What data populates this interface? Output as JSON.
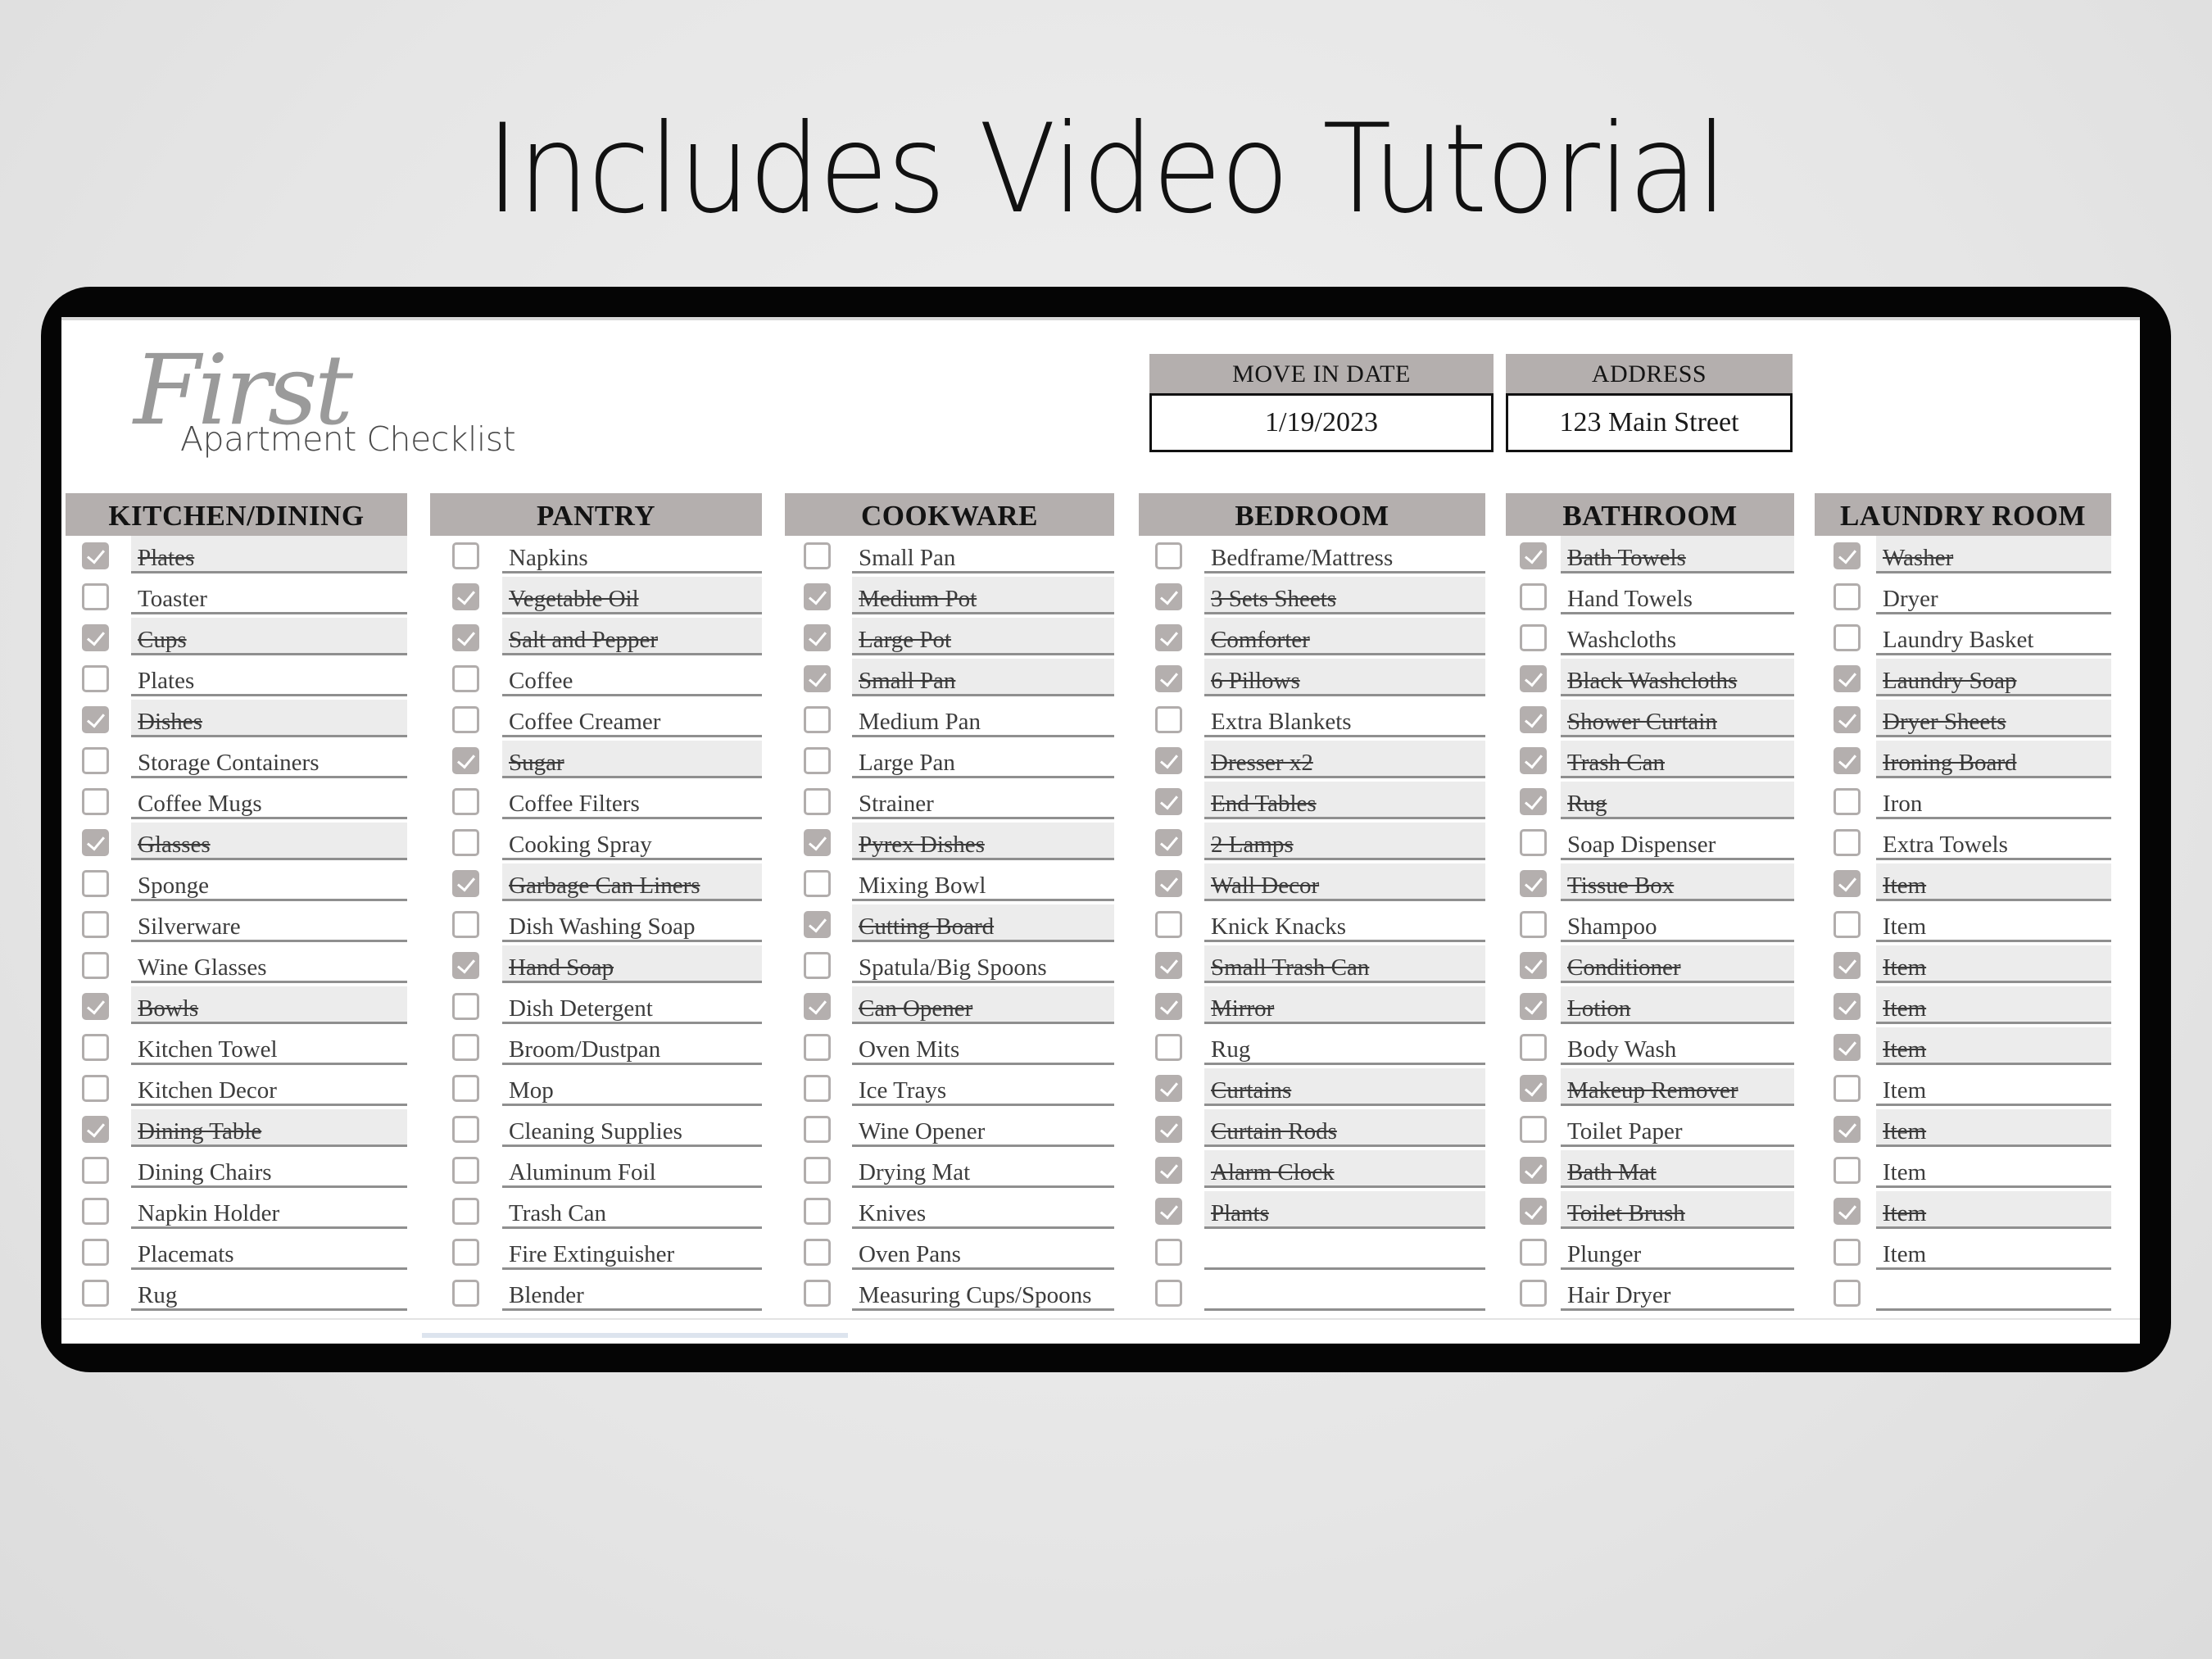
{
  "headline": "Includes Video Tutorial",
  "logo": {
    "script": "First",
    "subtitle": "Apartment Checklist"
  },
  "move_in": {
    "label": "MOVE IN DATE",
    "value": "1/19/2023"
  },
  "address": {
    "label": "ADDRESS",
    "value": "123 Main Street"
  },
  "colors": {
    "header_bg": "#b4afae",
    "checked_row_bg": "#ececec",
    "frame": "#050505"
  },
  "sections": [
    {
      "title": "KITCHEN/DINING",
      "items": [
        {
          "label": "Plates",
          "checked": true
        },
        {
          "label": "Toaster",
          "checked": false
        },
        {
          "label": "Cups",
          "checked": true
        },
        {
          "label": "Plates",
          "checked": false
        },
        {
          "label": "Dishes",
          "checked": true
        },
        {
          "label": "Storage Containers",
          "checked": false
        },
        {
          "label": "Coffee Mugs",
          "checked": false
        },
        {
          "label": "Glasses",
          "checked": true
        },
        {
          "label": "Sponge",
          "checked": false
        },
        {
          "label": "Silverware",
          "checked": false
        },
        {
          "label": "Wine Glasses",
          "checked": false
        },
        {
          "label": "Bowls",
          "checked": true
        },
        {
          "label": "Kitchen Towel",
          "checked": false
        },
        {
          "label": "Kitchen Decor",
          "checked": false
        },
        {
          "label": "Dining Table",
          "checked": true
        },
        {
          "label": "Dining Chairs",
          "checked": false
        },
        {
          "label": "Napkin Holder",
          "checked": false
        },
        {
          "label": "Placemats",
          "checked": false
        },
        {
          "label": "Rug",
          "checked": false
        }
      ]
    },
    {
      "title": "PANTRY",
      "items": [
        {
          "label": "Napkins",
          "checked": false
        },
        {
          "label": "Vegetable Oil",
          "checked": true
        },
        {
          "label": "Salt and Pepper",
          "checked": true
        },
        {
          "label": "Coffee",
          "checked": false
        },
        {
          "label": "Coffee Creamer",
          "checked": false
        },
        {
          "label": "Sugar",
          "checked": true
        },
        {
          "label": "Coffee Filters",
          "checked": false
        },
        {
          "label": "Cooking Spray",
          "checked": false
        },
        {
          "label": "Garbage Can Liners",
          "checked": true
        },
        {
          "label": "Dish Washing Soap",
          "checked": false
        },
        {
          "label": "Hand Soap",
          "checked": true
        },
        {
          "label": "Dish Detergent",
          "checked": false
        },
        {
          "label": "Broom/Dustpan",
          "checked": false
        },
        {
          "label": "Mop",
          "checked": false
        },
        {
          "label": "Cleaning Supplies",
          "checked": false
        },
        {
          "label": "Aluminum Foil",
          "checked": false
        },
        {
          "label": "Trash Can",
          "checked": false
        },
        {
          "label": "Fire Extinguisher",
          "checked": false
        },
        {
          "label": "Blender",
          "checked": false
        }
      ]
    },
    {
      "title": "COOKWARE",
      "items": [
        {
          "label": "Small Pan",
          "checked": false
        },
        {
          "label": "Medium Pot",
          "checked": true
        },
        {
          "label": "Large Pot",
          "checked": true
        },
        {
          "label": "Small Pan",
          "checked": true
        },
        {
          "label": "Medium Pan",
          "checked": false
        },
        {
          "label": "Large Pan",
          "checked": false
        },
        {
          "label": "Strainer",
          "checked": false
        },
        {
          "label": "Pyrex Dishes",
          "checked": true
        },
        {
          "label": "Mixing Bowl",
          "checked": false
        },
        {
          "label": "Cutting Board",
          "checked": true
        },
        {
          "label": "Spatula/Big Spoons",
          "checked": false
        },
        {
          "label": "Can Opener",
          "checked": true
        },
        {
          "label": "Oven Mits",
          "checked": false
        },
        {
          "label": "Ice Trays",
          "checked": false
        },
        {
          "label": "Wine Opener",
          "checked": false
        },
        {
          "label": "Drying Mat",
          "checked": false
        },
        {
          "label": "Knives",
          "checked": false
        },
        {
          "label": "Oven Pans",
          "checked": false
        },
        {
          "label": "Measuring Cups/Spoons",
          "checked": false
        }
      ]
    },
    {
      "title": "BEDROOM",
      "items": [
        {
          "label": "Bedframe/Mattress",
          "checked": false
        },
        {
          "label": "3 Sets Sheets",
          "checked": true
        },
        {
          "label": "Comforter",
          "checked": true
        },
        {
          "label": "6 Pillows",
          "checked": true
        },
        {
          "label": "Extra Blankets",
          "checked": false
        },
        {
          "label": "Dresser x2",
          "checked": true
        },
        {
          "label": "End Tables",
          "checked": true
        },
        {
          "label": "2 Lamps",
          "checked": true
        },
        {
          "label": "Wall Decor",
          "checked": true
        },
        {
          "label": "Knick Knacks",
          "checked": false
        },
        {
          "label": "Small Trash Can",
          "checked": true
        },
        {
          "label": "Mirror",
          "checked": true
        },
        {
          "label": "Rug",
          "checked": false
        },
        {
          "label": "Curtains",
          "checked": true
        },
        {
          "label": "Curtain Rods",
          "checked": true
        },
        {
          "label": "Alarm Clock",
          "checked": true
        },
        {
          "label": "Plants",
          "checked": true
        },
        {
          "label": "",
          "checked": false
        },
        {
          "label": "",
          "checked": false
        }
      ]
    },
    {
      "title": "BATHROOM",
      "items": [
        {
          "label": "Bath Towels",
          "checked": true
        },
        {
          "label": "Hand Towels",
          "checked": false
        },
        {
          "label": "Washcloths",
          "checked": false
        },
        {
          "label": "Black Washcloths",
          "checked": true
        },
        {
          "label": "Shower Curtain",
          "checked": true
        },
        {
          "label": "Trash Can",
          "checked": true
        },
        {
          "label": "Rug",
          "checked": true
        },
        {
          "label": "Soap Dispenser",
          "checked": false
        },
        {
          "label": "Tissue Box",
          "checked": true
        },
        {
          "label": "Shampoo",
          "checked": false
        },
        {
          "label": "Conditioner",
          "checked": true
        },
        {
          "label": "Lotion",
          "checked": true
        },
        {
          "label": "Body Wash",
          "checked": false
        },
        {
          "label": "Makeup Remover",
          "checked": true
        },
        {
          "label": "Toilet Paper",
          "checked": false
        },
        {
          "label": "Bath Mat",
          "checked": true
        },
        {
          "label": "Toilet Brush",
          "checked": true
        },
        {
          "label": "Plunger",
          "checked": false
        },
        {
          "label": "Hair Dryer",
          "checked": false
        }
      ]
    },
    {
      "title": "LAUNDRY ROOM",
      "items": [
        {
          "label": "Washer",
          "checked": true
        },
        {
          "label": "Dryer",
          "checked": false
        },
        {
          "label": "Laundry Basket",
          "checked": false
        },
        {
          "label": "Laundry Soap",
          "checked": true
        },
        {
          "label": "Dryer Sheets",
          "checked": true
        },
        {
          "label": "Ironing Board",
          "checked": true
        },
        {
          "label": "Iron",
          "checked": false
        },
        {
          "label": "Extra Towels",
          "checked": false
        },
        {
          "label": "Item",
          "checked": true
        },
        {
          "label": "Item",
          "checked": false
        },
        {
          "label": "Item",
          "checked": true
        },
        {
          "label": "Item",
          "checked": true
        },
        {
          "label": "Item",
          "checked": true
        },
        {
          "label": "Item",
          "checked": false
        },
        {
          "label": "Item",
          "checked": true
        },
        {
          "label": "Item",
          "checked": false
        },
        {
          "label": "Item",
          "checked": true
        },
        {
          "label": "Item",
          "checked": false
        },
        {
          "label": "",
          "checked": false
        }
      ]
    }
  ]
}
